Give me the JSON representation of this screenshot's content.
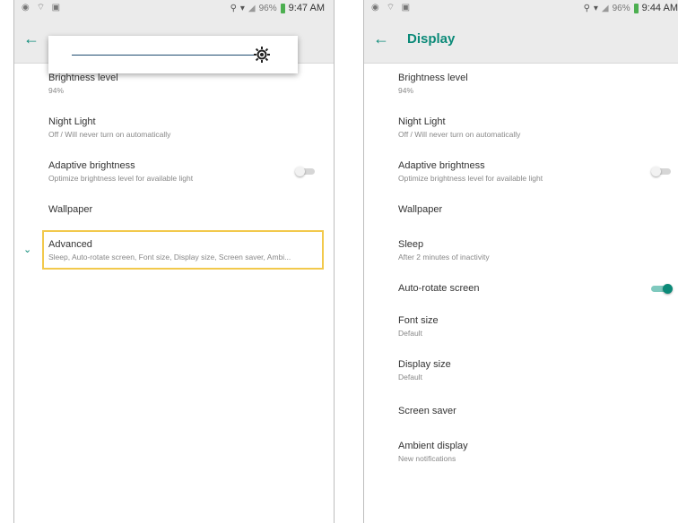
{
  "left_phone": {
    "status": {
      "battery": "96%",
      "time": "9:47 AM"
    },
    "brightness": {
      "title": "Brightness level",
      "value": "94%",
      "level": 0.94
    },
    "night_light": {
      "title": "Night Light",
      "subtitle": "Off / Will never turn on automatically"
    },
    "adaptive": {
      "title": "Adaptive brightness",
      "subtitle": "Optimize brightness level for available light",
      "enabled": false
    },
    "wallpaper": {
      "title": "Wallpaper"
    },
    "advanced": {
      "title": "Advanced",
      "subtitle": "Sleep, Auto-rotate screen, Font size, Display size, Screen saver, Ambi..."
    }
  },
  "right_phone": {
    "status": {
      "battery": "96%",
      "time": "9:44 AM"
    },
    "app_bar": {
      "title": "Display"
    },
    "brightness": {
      "title": "Brightness level",
      "value": "94%"
    },
    "night_light": {
      "title": "Night Light",
      "subtitle": "Off / Will never turn on automatically"
    },
    "adaptive": {
      "title": "Adaptive brightness",
      "subtitle": "Optimize brightness level for available light",
      "enabled": false
    },
    "wallpaper": {
      "title": "Wallpaper"
    },
    "sleep": {
      "title": "Sleep",
      "subtitle": "After 2 minutes of inactivity"
    },
    "auto_rotate": {
      "title": "Auto-rotate screen",
      "enabled": true
    },
    "font_size": {
      "title": "Font size",
      "subtitle": "Default"
    },
    "display_size": {
      "title": "Display size",
      "subtitle": "Default"
    },
    "screen_saver": {
      "title": "Screen saver"
    },
    "ambient": {
      "title": "Ambient display",
      "subtitle": "New notifications"
    }
  },
  "colors": {
    "accent": "#0b8a78",
    "highlight": "#f2c94c",
    "app_bar_bg": "#ebebeb"
  }
}
